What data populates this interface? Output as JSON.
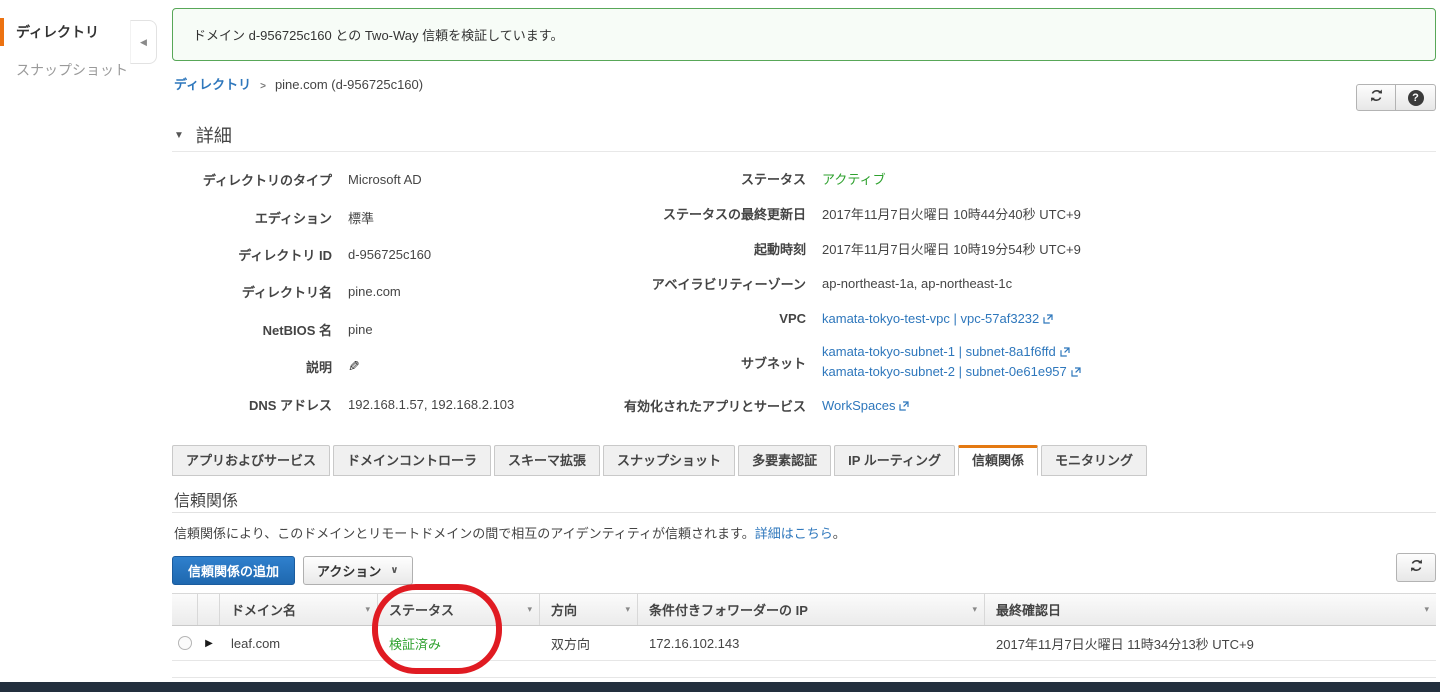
{
  "icons": {
    "sidebar_collapse": "◀",
    "details_collapse": "▼",
    "breadcrumb_separator": ">",
    "edit_pencil": "✎",
    "actions_chevron": "∨",
    "sort_arrow": "▾",
    "row_expand": "▶",
    "help": "?"
  },
  "sidebar": {
    "items": [
      {
        "label": "ディレクトリ"
      },
      {
        "label": "スナップショット"
      }
    ]
  },
  "banner": {
    "message": "ドメイン d-956725c160 との Two-Way 信頼を検証しています。"
  },
  "breadcrumb": {
    "root": "ディレクトリ",
    "current": "pine.com (d-956725c160)"
  },
  "details": {
    "title": "詳細",
    "left": [
      {
        "label": "ディレクトリのタイプ",
        "value": "Microsoft AD"
      },
      {
        "label": "エディション",
        "value": "標準"
      },
      {
        "label": "ディレクトリ ID",
        "value": "d-956725c160"
      },
      {
        "label": "ディレクトリ名",
        "value": "pine.com"
      },
      {
        "label": "NetBIOS 名",
        "value": "pine"
      },
      {
        "label": "説明",
        "value": ""
      },
      {
        "label": "DNS アドレス",
        "value": "192.168.1.57, 192.168.2.103"
      }
    ],
    "right": [
      {
        "label": "ステータス",
        "value": "アクティブ"
      },
      {
        "label": "ステータスの最終更新日",
        "value": "2017年11月7日火曜日 10時44分40秒 UTC+9"
      },
      {
        "label": "起動時刻",
        "value": "2017年11月7日火曜日 10時19分54秒 UTC+9"
      },
      {
        "label": "アベイラビリティーゾーン",
        "value": "ap-northeast-1a, ap-northeast-1c"
      },
      {
        "label": "VPC",
        "links": [
          "kamata-tokyo-test-vpc | vpc-57af3232"
        ]
      },
      {
        "label": "サブネット",
        "links": [
          "kamata-tokyo-subnet-1 | subnet-8a1f6ffd",
          "kamata-tokyo-subnet-2 | subnet-0e61e957"
        ]
      },
      {
        "label": "有効化されたアプリとサービス",
        "links": [
          "WorkSpaces"
        ]
      }
    ]
  },
  "tabs": {
    "items": [
      {
        "label": "アプリおよびサービス"
      },
      {
        "label": "ドメインコントローラ"
      },
      {
        "label": "スキーマ拡張"
      },
      {
        "label": "スナップショット"
      },
      {
        "label": "多要素認証"
      },
      {
        "label": "IP ルーティング"
      },
      {
        "label": "信頼関係"
      },
      {
        "label": "モニタリング"
      }
    ],
    "active_index": 6
  },
  "trust": {
    "title": "信頼関係",
    "description": "信頼関係により、このドメインとリモートドメインの間で相互のアイデンティティが信頼されます。",
    "description_link": "詳細はこちら",
    "description_suffix": "。",
    "add_button": "信頼関係の追加",
    "actions_button": "アクション",
    "table": {
      "columns": [
        "ドメイン名",
        "ステータス",
        "方向",
        "条件付きフォワーダーの IP",
        "最終確認日"
      ],
      "rows": [
        {
          "domain": "leaf.com",
          "status": "検証済み",
          "direction": "双方向",
          "forwarder_ip": "172.16.102.143",
          "last_checked": "2017年11月7日火曜日 11時34分13秒 UTC+9"
        }
      ]
    }
  },
  "annotation": {
    "color": "#e01b22",
    "target": "ステータス 検証済み"
  },
  "colors": {
    "accent_orange": "#ec7211",
    "link_blue": "#2e77bc",
    "status_green": "#2ea12e",
    "banner_border": "#58a758",
    "footer_navy": "#232f3e",
    "primary_button": "#2472bf"
  }
}
